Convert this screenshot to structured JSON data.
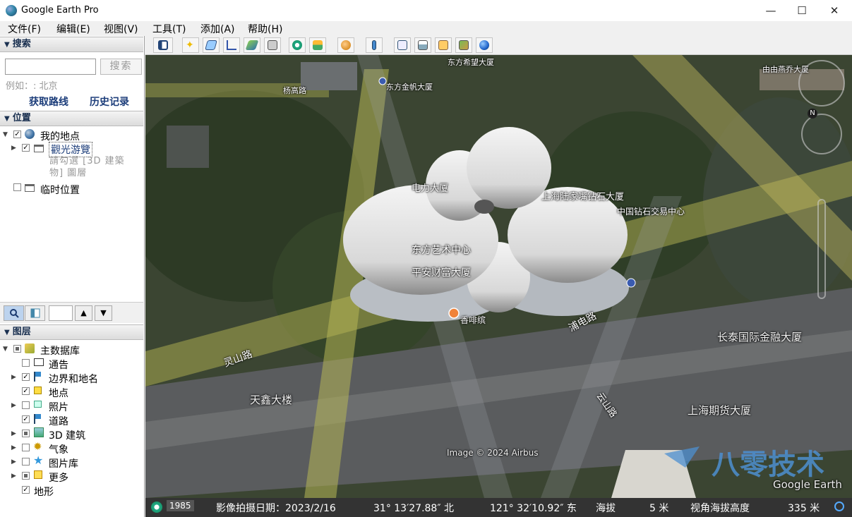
{
  "window": {
    "title": "Google Earth Pro",
    "minimize": "—",
    "maximize": "☐",
    "close": "✕"
  },
  "menu": [
    "文件(F)",
    "编辑(E)",
    "视图(V)",
    "工具(T)",
    "添加(A)",
    "帮助(H)"
  ],
  "search": {
    "header": "搜索",
    "button": "搜索",
    "hint": "例如：: 北京",
    "get_directions": "获取路线",
    "history": "历史记录"
  },
  "places": {
    "header": "位置",
    "my_places": "我的地点",
    "sightseeing": "觀光游覽",
    "sightseeing_hint": "請勾選 [3D 建築物] 圖層",
    "temporary": "临时位置"
  },
  "layers": {
    "header": "图层",
    "primary_db": "主数据库",
    "items": [
      "通告",
      "边界和地名",
      "地点",
      "照片",
      "道路",
      "3D 建筑",
      "气象",
      "图片库",
      "更多",
      "地形"
    ]
  },
  "map": {
    "labels": {
      "dongfang_art_center": "东方艺术中心",
      "pingan_tower": "平安财富大厦",
      "power_tower": "电力大厦",
      "lujiazui_diamond": "上海陆家嘴钻石大厦",
      "diamond_exchange": "中国钻石交易中心",
      "coffee": "香啡缤",
      "changtai": "长泰国际金融大厦",
      "tianxin": "天鑫大楼",
      "futures": "上海期货大厦",
      "dongfang_hope": "东方希望大厦",
      "dongfang_jinmao": "东方金帆大厦",
      "yanggao_rd": "杨高路",
      "lingshan_rd": "灵山路",
      "huaxi_rd": "浦电路",
      "zhengshan_rd": "云山路",
      "youyi": "由由燕乔大厦"
    },
    "copyright": "Image © 2024 Airbus",
    "watermark": "八零技术",
    "brand": "Google Earth",
    "compass_n": "N"
  },
  "status": {
    "year": "1985",
    "imagery_date": "影像拍摄日期：2023/2/16",
    "lat": "31° 13′27.88″ 北",
    "lon": "121° 32′10.92″ 东",
    "elevation_label": "海拔",
    "elevation": "5 米",
    "eye_alt_label": "视角海拔高度",
    "eye_alt": "335 米"
  }
}
